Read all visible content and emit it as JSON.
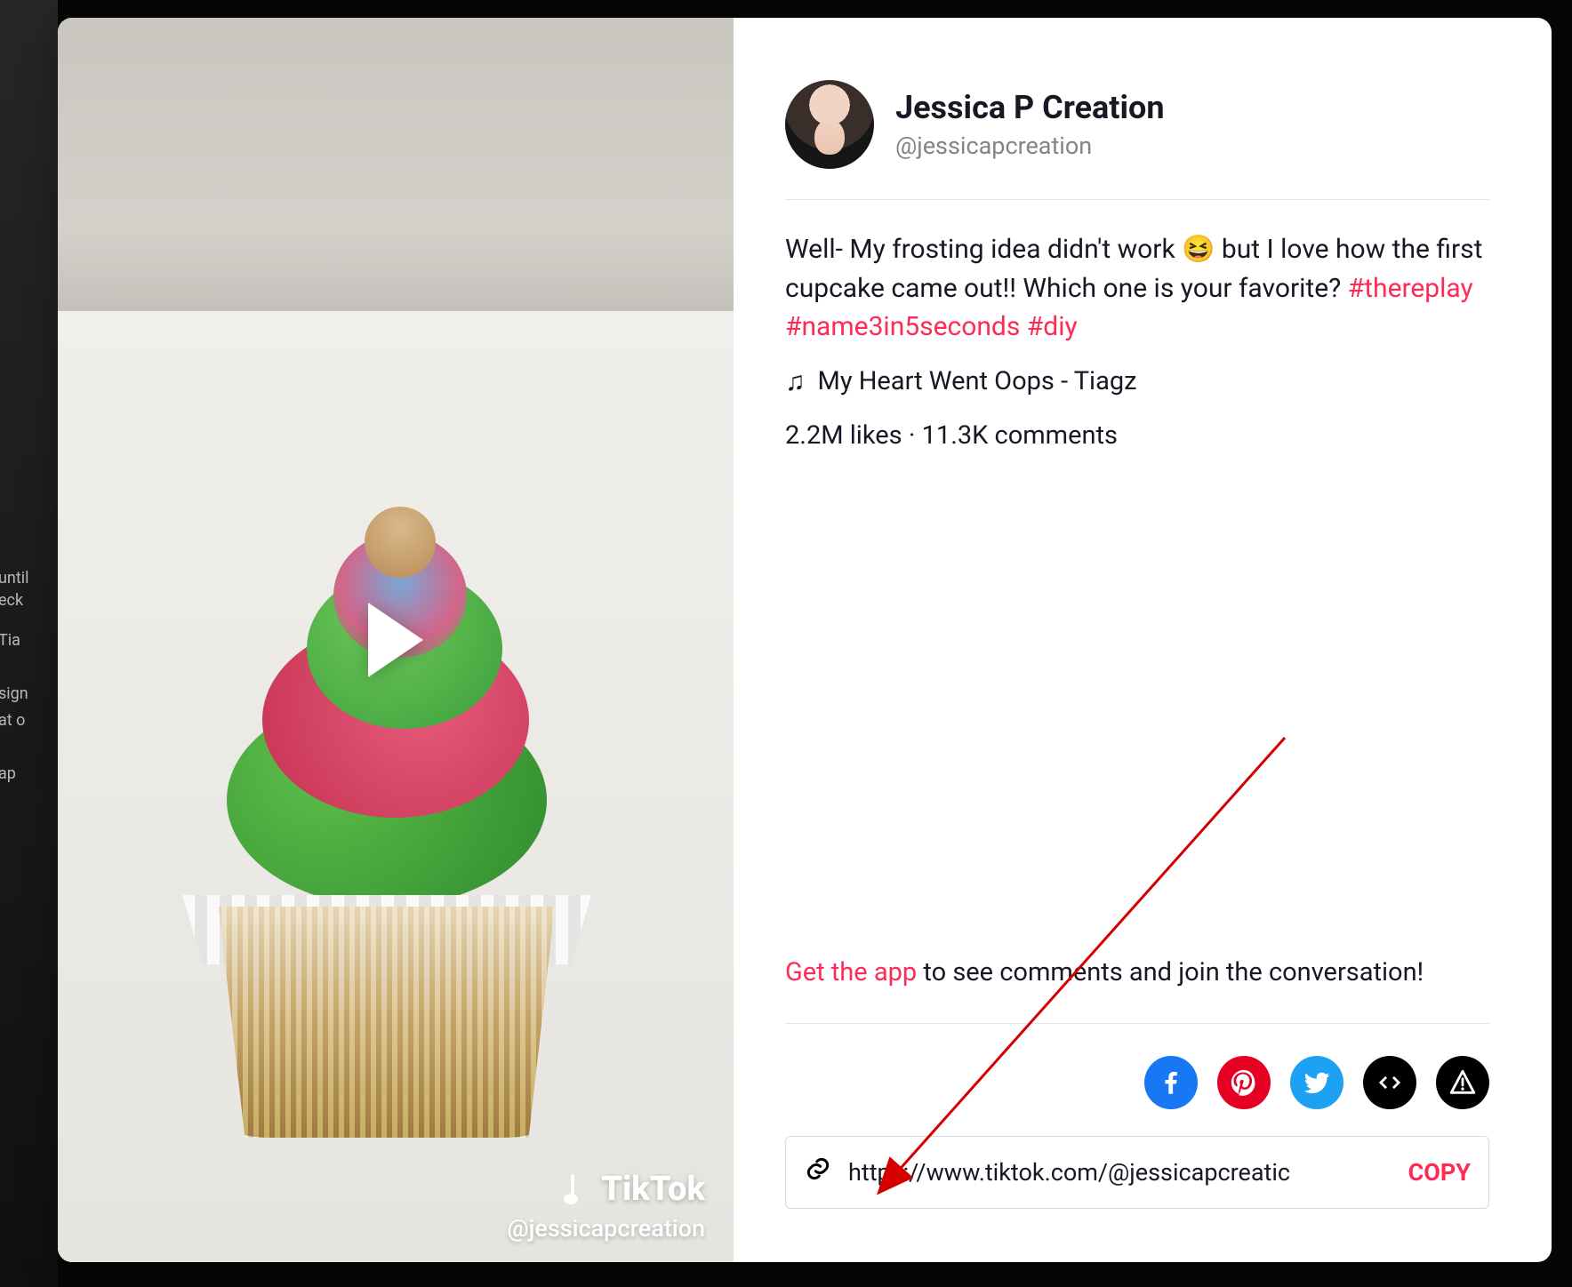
{
  "profile": {
    "display_name": "Jessica P Creation",
    "username": "@jessicapcreation"
  },
  "video": {
    "watermark_label": "TikTok",
    "handle": "@jessicapcreation"
  },
  "caption": {
    "text": "Well- My frosting idea didn't work 😆  but I love how the first cupcake came out!! Which one is your favorite? ",
    "tags": [
      "#thereplay",
      "#name3in5seconds",
      "#diy"
    ]
  },
  "music": {
    "label": "My Heart Went Oops - Tiagz"
  },
  "stats": {
    "likes": "2.2M likes",
    "separator": " · ",
    "comments": "11.3K comments"
  },
  "cta": {
    "link_text": "Get the app",
    "rest": " to see comments and join the conversation!"
  },
  "share": {
    "url": "https://www.tiktok.com/@jessicapcreatic",
    "copy_label": "COPY"
  },
  "share_buttons": {
    "facebook": "facebook",
    "pinterest": "pinterest",
    "twitter": "twitter",
    "embed": "embed",
    "report": "report"
  }
}
